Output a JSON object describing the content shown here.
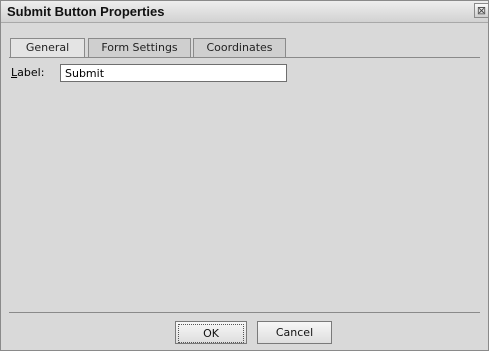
{
  "window": {
    "title": "Submit Button Properties",
    "close_symbol": "⊠"
  },
  "tabs": [
    {
      "label": "General",
      "active": true
    },
    {
      "label": "Form Settings",
      "active": false
    },
    {
      "label": "Coordinates",
      "active": false
    }
  ],
  "general": {
    "label_field": {
      "label_accel": "L",
      "label_rest": "abel:",
      "value": "Submit"
    }
  },
  "buttons": {
    "ok": "OK",
    "cancel": "Cancel"
  },
  "icons": {
    "close": "close-icon"
  }
}
